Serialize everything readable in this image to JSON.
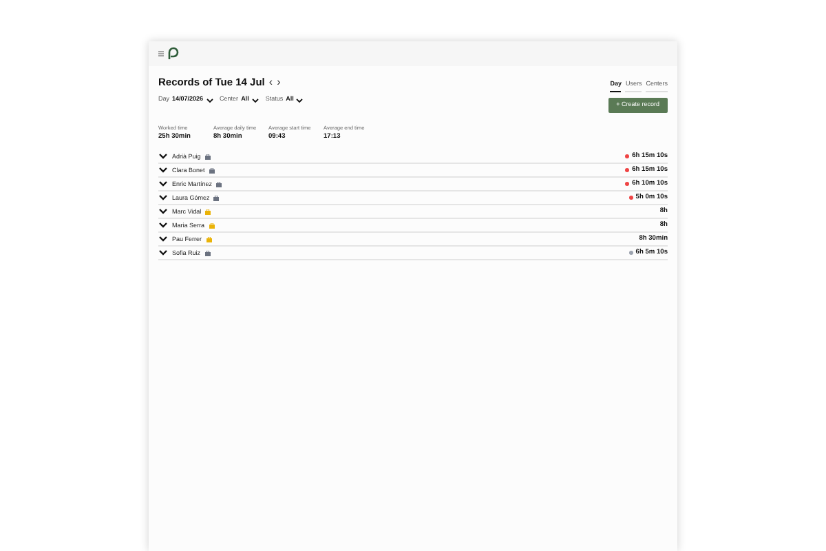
{
  "header": {
    "title": "Records of Tue 14 Jul",
    "prev": "‹",
    "next": "›"
  },
  "tabs": [
    {
      "label": "Day",
      "selected": true
    },
    {
      "label": "Users",
      "selected": false
    },
    {
      "label": "Centers",
      "selected": false
    }
  ],
  "filters": [
    {
      "label": "Day",
      "value": "14/07/2026"
    },
    {
      "label": "Center",
      "value": "All"
    },
    {
      "label": "Status",
      "value": "All"
    }
  ],
  "create_button": "+ Create record",
  "stats": [
    {
      "label": "Worked time",
      "value": "25h 30min"
    },
    {
      "label": "Average daily time",
      "value": "8h 30min"
    },
    {
      "label": "Average start time",
      "value": "09:43"
    },
    {
      "label": "Average end time",
      "value": "17:13"
    }
  ],
  "rows": [
    {
      "name": "Adrià Puig",
      "icon": {
        "color": "#6b7280"
      },
      "total": "6h 15m 10s",
      "status_dot": {
        "color": "#ef4444"
      }
    },
    {
      "name": "Clara Bonet",
      "icon": {
        "color": "#6b7280"
      },
      "total": "6h 15m 10s",
      "status_dot": {
        "color": "#ef4444"
      }
    },
    {
      "name": "Enric Martínez",
      "icon": {
        "color": "#6b7280"
      },
      "total": "6h 10m 10s",
      "status_dot": {
        "color": "#ef4444"
      }
    },
    {
      "name": "Laura Gómez",
      "icon": {
        "color": "#6b7280"
      },
      "total": "5h 0m 10s",
      "status_dot": {
        "color": "#ef4444"
      }
    },
    {
      "name": "Marc Vidal",
      "icon": {
        "color": "#eab308"
      },
      "total": "8h"
    },
    {
      "name": "Maria Serra",
      "icon": {
        "color": "#eab308"
      },
      "total": "8h"
    },
    {
      "name": "Pau Ferrer",
      "icon": {
        "color": "#eab308"
      },
      "total": "8h 30min"
    },
    {
      "name": "Sofia Ruiz",
      "icon": {
        "color": "#6b7280"
      },
      "total": "6h 5m 10s",
      "status_dot": {
        "color": "#9ca3af"
      }
    }
  ]
}
